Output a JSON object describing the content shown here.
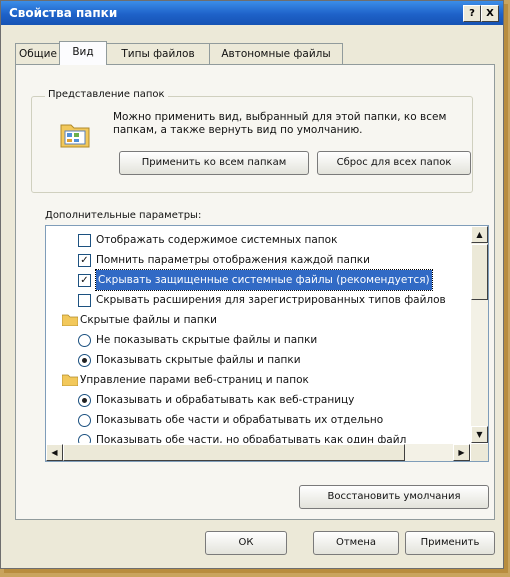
{
  "window": {
    "title": "Свойства папки",
    "help_btn": "?",
    "close_btn": "X"
  },
  "tabs": [
    {
      "label": "Общие"
    },
    {
      "label": "Вид"
    },
    {
      "label": "Типы файлов"
    },
    {
      "label": "Автономные файлы"
    }
  ],
  "folder_view": {
    "legend": "Представление папок",
    "description": "Можно применить вид, выбранный для этой папки, ко всем папкам, а также вернуть вид по умолчанию.",
    "apply_all_label": "Применить ко всем папкам",
    "reset_all_label": "Сброс для всех папок"
  },
  "advanced": {
    "label": "Дополнительные параметры:",
    "items": [
      {
        "kind": "checkbox",
        "checked": false,
        "text": "Отображать содержимое системных папок",
        "indent": 1
      },
      {
        "kind": "checkbox",
        "checked": true,
        "text": "Помнить параметры отображения каждой папки",
        "indent": 1
      },
      {
        "kind": "checkbox",
        "checked": true,
        "text": "Скрывать защищенные системные файлы (рекомендуется)",
        "indent": 1,
        "selected": true
      },
      {
        "kind": "checkbox",
        "checked": false,
        "text": "Скрывать расширения для зарегистрированных типов файлов",
        "indent": 1
      },
      {
        "kind": "folder",
        "text": "Скрытые файлы и папки",
        "indent": 0
      },
      {
        "kind": "radio",
        "checked": false,
        "text": "Не показывать скрытые файлы и папки",
        "indent": 1
      },
      {
        "kind": "radio",
        "checked": true,
        "text": "Показывать скрытые файлы и папки",
        "indent": 1
      },
      {
        "kind": "folder",
        "text": "Управление парами веб-страниц и папок",
        "indent": 0
      },
      {
        "kind": "radio",
        "checked": true,
        "text": "Показывать и обрабатывать как веб-страницу",
        "indent": 1
      },
      {
        "kind": "radio",
        "checked": false,
        "text": "Показывать обе части и обрабатывать их отдельно",
        "indent": 1
      },
      {
        "kind": "radio",
        "checked": false,
        "text": "Показывать обе части, но обрабатывать как один файл",
        "indent": 1
      }
    ],
    "restore_label": "Восстановить умолчания"
  },
  "footer": {
    "ok_label": "ОК",
    "cancel_label": "Отмена",
    "apply_label": "Применить"
  },
  "colors": {
    "titlebar": "#1e62c9",
    "selection": "#316ac5",
    "face": "#ece9d8"
  }
}
